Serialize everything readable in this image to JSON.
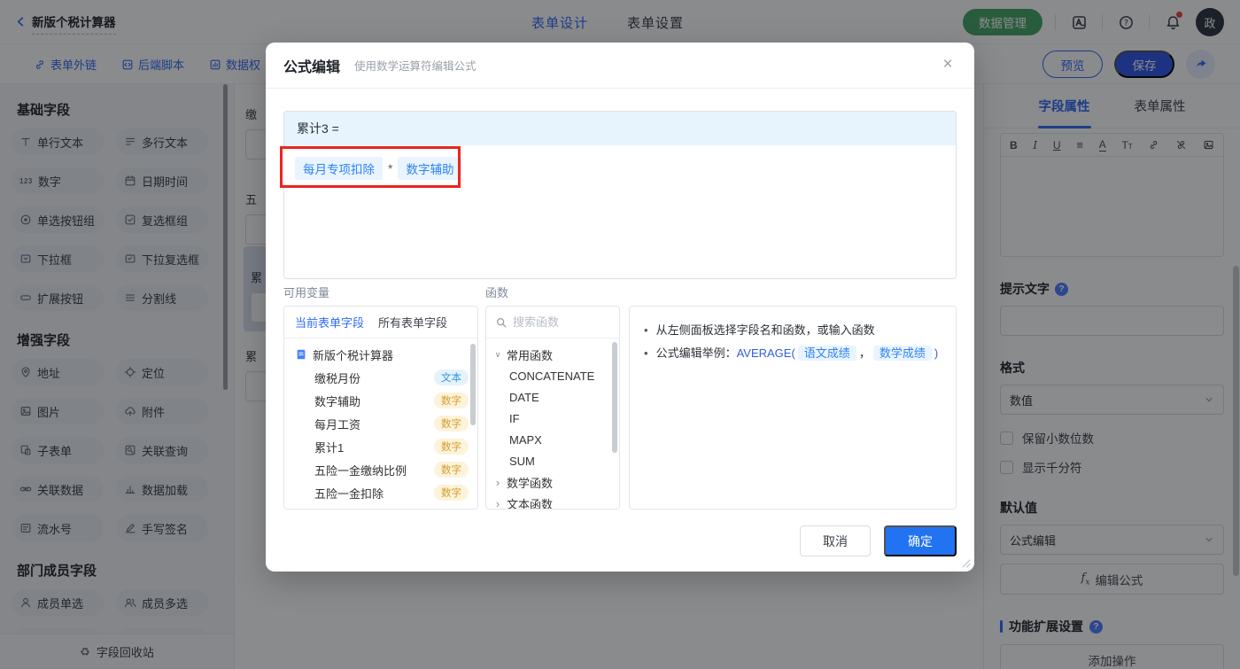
{
  "colors": {
    "accent_blue": "#2f6bf5",
    "green_button": "#45a564",
    "annotation_red": "#e8251f",
    "token_blue": "#2e83f0",
    "badge_text_blue": "#2a95d8",
    "badge_number_orange": "#d99b2b"
  },
  "topbar": {
    "title": "新版个税计算器",
    "tabs": [
      "表单设计",
      "表单设置"
    ],
    "active_tab": "表单设计",
    "data_manage_label": "数据管理",
    "icons": [
      "translate-icon",
      "help-icon",
      "bell-icon"
    ],
    "avatar_text": "政"
  },
  "toolbar": {
    "links": [
      {
        "icon": "link-icon",
        "label": "表单外链"
      },
      {
        "icon": "script-icon",
        "label": "后端脚本"
      },
      {
        "icon": "data-perm-icon",
        "label": "数据权"
      }
    ],
    "preview_label": "预览",
    "save_label": "保存"
  },
  "sidebar": {
    "groups": [
      {
        "title": "基础字段",
        "partial_row": false,
        "items": [
          {
            "icon": "text-icon",
            "label": "单行文本"
          },
          {
            "icon": "multiline-text-icon",
            "label": "多行文本"
          },
          {
            "icon": "number-icon",
            "label": "数字"
          },
          {
            "icon": "datetime-icon",
            "label": "日期时间"
          },
          {
            "icon": "radio-icon",
            "label": "单选按钮组"
          },
          {
            "icon": "checkbox-group-icon",
            "label": "复选框组"
          },
          {
            "icon": "select-icon",
            "label": "下拉框"
          },
          {
            "icon": "multiselect-icon",
            "label": "下拉复选框"
          },
          {
            "icon": "ext-button-icon",
            "label": "扩展按钮"
          },
          {
            "icon": "divider-icon",
            "label": "分割线"
          }
        ]
      },
      {
        "title": "增强字段",
        "partial_row": false,
        "items": [
          {
            "icon": "address-icon",
            "label": "地址"
          },
          {
            "icon": "location-icon",
            "label": "定位"
          },
          {
            "icon": "image-icon",
            "label": "图片"
          },
          {
            "icon": "attachment-icon",
            "label": "附件"
          },
          {
            "icon": "subform-icon",
            "label": "子表单"
          },
          {
            "icon": "lookup-icon",
            "label": "关联查询"
          },
          {
            "icon": "linkdata-icon",
            "label": "关联数据"
          },
          {
            "icon": "dataload-icon",
            "label": "数据加载"
          },
          {
            "icon": "serial-icon",
            "label": "流水号"
          },
          {
            "icon": "signature-icon",
            "label": "手写签名"
          }
        ]
      },
      {
        "title": "部门成员字段",
        "partial_row": true,
        "items": [
          {
            "icon": "user-icon",
            "label": "成员单选"
          },
          {
            "icon": "users-icon",
            "label": "成员多选"
          }
        ]
      }
    ],
    "recycle_icon": "recycle-icon",
    "recycle_label": "字段回收站"
  },
  "canvas": {
    "fields": [
      {
        "label": "缴",
        "selected": false
      },
      {
        "label": "五",
        "selected": false
      },
      {
        "label": "累",
        "selected": true
      },
      {
        "label": "累",
        "selected": false
      }
    ]
  },
  "modal": {
    "title": "公式编辑",
    "subtitle": "使用数学运算符编辑公式",
    "close_icon": "close-icon",
    "formula": {
      "target": "累计3 =",
      "tokens": [
        {
          "type": "field",
          "text": "每月专项扣除"
        },
        {
          "type": "op",
          "text": "*"
        },
        {
          "type": "field",
          "text": "数字辅助"
        }
      ]
    },
    "variables": {
      "label": "可用变量",
      "tabs": [
        "当前表单字段",
        "所有表单字段"
      ],
      "active_tab": "当前表单字段",
      "root": "新版个税计算器",
      "fields": [
        {
          "name": "缴税月份",
          "type": "文本"
        },
        {
          "name": "数字辅助",
          "type": "数字"
        },
        {
          "name": "每月工资",
          "type": "数字"
        },
        {
          "name": "累计1",
          "type": "数字"
        },
        {
          "name": "五险一金缴纳比例",
          "type": "数字"
        },
        {
          "name": "五险一金扣除",
          "type": "数字"
        }
      ]
    },
    "functions": {
      "label": "函数",
      "search_placeholder": "搜索函数",
      "groups": [
        {
          "name": "常用函数",
          "expanded": true,
          "items": [
            "CONCATENATE",
            "DATE",
            "IF",
            "MAPX",
            "SUM"
          ]
        },
        {
          "name": "数学函数",
          "expanded": false,
          "items": []
        },
        {
          "name": "文本函数",
          "expanded": false,
          "items": []
        }
      ]
    },
    "help": {
      "line1": "从左侧面板选择字段名和函数，或输入函数",
      "line2_prefix": "公式编辑举例：",
      "fn": "AVERAGE(",
      "token1": "语文成绩",
      "comma": "，",
      "token2": "数学成绩",
      "close": ")"
    },
    "cancel_label": "取消",
    "confirm_label": "确定"
  },
  "panel": {
    "tabs": [
      "字段属性",
      "表单属性"
    ],
    "active_tab": "字段属性",
    "toolbar_icons": [
      "bold-icon",
      "italic-icon",
      "underline-icon",
      "align-icon",
      "font-color-icon",
      "text-size-icon",
      "link-icon",
      "unlink-icon",
      "image-icon"
    ],
    "hint_label": "提示文字",
    "format_label": "格式",
    "format_value": "数值",
    "checkboxes": [
      "保留小数位数",
      "显示千分符"
    ],
    "default_label": "默认值",
    "default_value": "公式编辑",
    "fx_label": "fx",
    "edit_formula_label": "编辑公式",
    "ext_label": "功能扩展设置",
    "add_action_label": "添加操作"
  }
}
